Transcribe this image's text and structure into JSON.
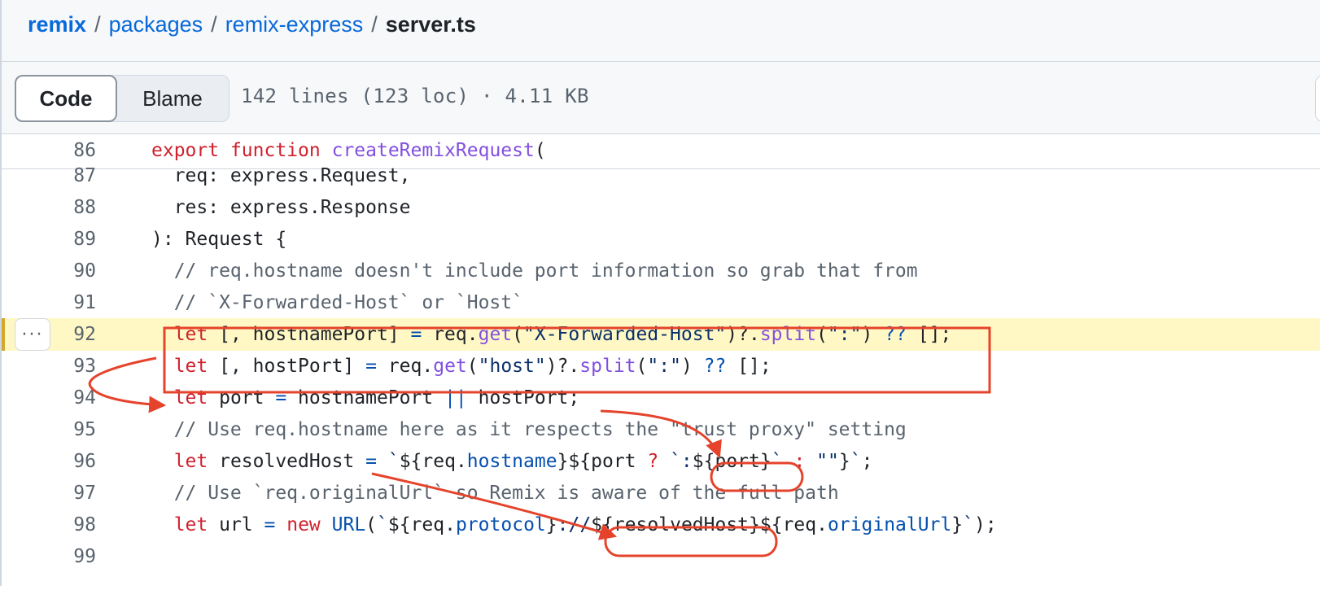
{
  "breadcrumb": {
    "items": [
      "remix",
      "packages",
      "remix-express"
    ],
    "separator": "/",
    "current": "server.ts"
  },
  "tabs": [
    {
      "label": "Code",
      "active": true
    },
    {
      "label": "Blame",
      "active": false
    }
  ],
  "file_stats": "142 lines (123 loc) · 4.11 KB",
  "more_button_label": "···",
  "code_lines": [
    {
      "num": "86",
      "text": "export function createRemixRequest("
    },
    {
      "num": "87",
      "text": "  req: express.Request,"
    },
    {
      "num": "88",
      "text": "  res: express.Response"
    },
    {
      "num": "89",
      "text": "): Request {"
    },
    {
      "num": "90",
      "text": "  // req.hostname doesn't include port information so grab that from"
    },
    {
      "num": "91",
      "text": "  // `X-Forwarded-Host` or `Host`"
    },
    {
      "num": "92",
      "text": "  let [, hostnamePort] = req.get(\"X-Forwarded-Host\")?.split(\":\") ?? [];"
    },
    {
      "num": "93",
      "text": "  let [, hostPort] = req.get(\"host\")?.split(\":\") ?? [];"
    },
    {
      "num": "94",
      "text": "  let port = hostnamePort || hostPort;"
    },
    {
      "num": "95",
      "text": "  // Use req.hostname here as it respects the \"trust proxy\" setting"
    },
    {
      "num": "96",
      "text": "  let resolvedHost = `${req.hostname}${port ? `:${port}` : \"\"}`;"
    },
    {
      "num": "97",
      "text": "  // Use `req.originalUrl` so Remix is aware of the full path"
    },
    {
      "num": "98",
      "text": "  let url = new URL(`${req.protocol}://${resolvedHost}${req.originalUrl}`);"
    },
    {
      "num": "99",
      "text": ""
    }
  ],
  "colors": {
    "link": "#0969da",
    "keyword": "#cf222e",
    "function": "#8250df",
    "string": "#0a3069",
    "property": "#0550ae",
    "comment": "#59636e",
    "highlight": "#fff8c5",
    "annotation": "#e5432b"
  }
}
